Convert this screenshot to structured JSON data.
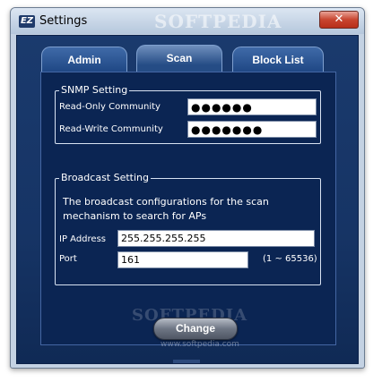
{
  "window": {
    "title": "Settings",
    "app_icon": "EZ",
    "close_glyph": "✕",
    "watermark": "SOFTPEDIA"
  },
  "tabs": [
    {
      "label": "Admin",
      "active": false
    },
    {
      "label": "Scan",
      "active": true
    },
    {
      "label": "Block List",
      "active": false
    }
  ],
  "snmp": {
    "title": "SNMP Setting",
    "read_only_label": "Read-Only Community",
    "read_only_value": "●●●●●●",
    "read_write_label": "Read-Write Community",
    "read_write_value": "●●●●●●●"
  },
  "broadcast": {
    "title": "Broadcast Setting",
    "description": "The broadcast configurations for the scan mechanism to search for APs",
    "ip_label": "IP Address",
    "ip_value": "255.255.255.255",
    "port_label": "Port",
    "port_value": "161",
    "port_range": "(1 ~ 65536)"
  },
  "actions": {
    "change_label": "Change"
  },
  "watermark_bottom": "SOFTPEDIA",
  "watermark_url": "www.softpedia.com",
  "colors": {
    "background": "#102a55",
    "panel": "#0b2553",
    "tab": "#2a5290",
    "close": "#c8452f"
  }
}
